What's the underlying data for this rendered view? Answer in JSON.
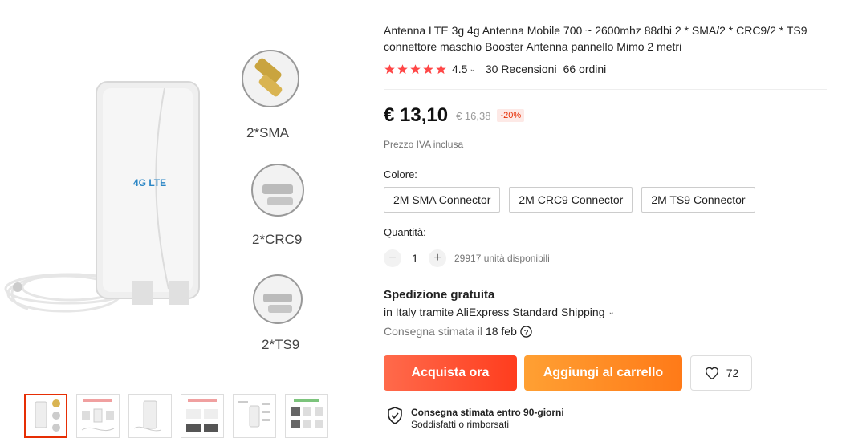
{
  "product": {
    "title": "Antenna LTE 3g 4g Antenna Mobile 700 ~ 2600mhz 88dbi 2 * SMA/2 * CRC9/2 * TS9 connettore maschio Booster Antenna pannello Mimo 2 metri",
    "image_labels": [
      "2*SMA",
      "2*CRC9",
      "2*TS9"
    ],
    "logo_text": "4G LTE",
    "thumbnail_count": 6
  },
  "rating": {
    "stars": 5,
    "value": "4.5",
    "reviews": "30 Recensioni",
    "orders": "66 ordini"
  },
  "price": {
    "current": "€ 13,10",
    "original": "€ 16,38",
    "discount": "-20%",
    "vat_note": "Prezzo IVA inclusa"
  },
  "options": {
    "color_label": "Colore:",
    "variants": [
      "2M SMA Connector",
      "2M CRC9 Connector",
      "2M TS9 Connector"
    ]
  },
  "quantity": {
    "label": "Quantità:",
    "value": "1",
    "available": "29917 unità disponibili"
  },
  "shipping": {
    "title": "Spedizione gratuita",
    "method": "in Italy tramite AliExpress Standard Shipping",
    "estimate_label": "Consegna stimata il",
    "estimate_date": "18 feb"
  },
  "actions": {
    "buy_now": "Acquista ora",
    "add_to_cart": "Aggiungi al carrello",
    "wishlist_count": "72"
  },
  "guarantee": {
    "title": "Consegna stimata entro 90-giorni",
    "subtitle": "Soddisfatti o rimborsati"
  },
  "colors": {
    "accent": "#ff4747",
    "buy": "#ff3d1e",
    "cart": "#ff8a1f",
    "star": "#ff4747",
    "discount": "#e62e04"
  }
}
